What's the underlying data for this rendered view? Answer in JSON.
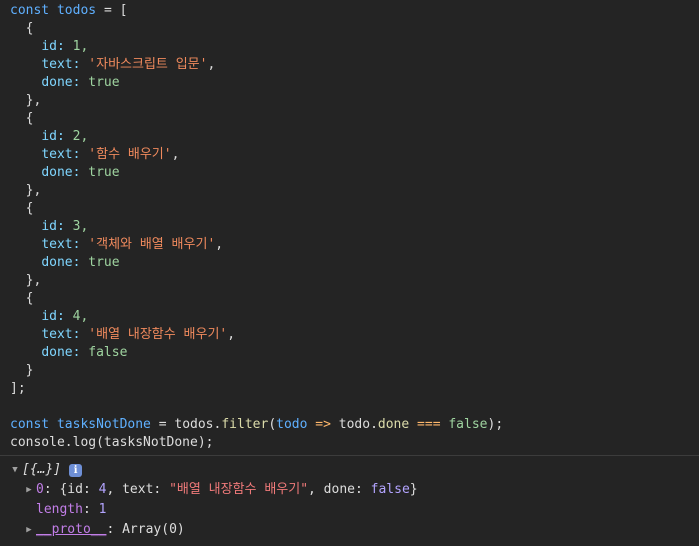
{
  "code": {
    "kw_const": "const",
    "todos_name": "todos",
    "eq": "=",
    "open_bracket": "[",
    "close_bracket": "];",
    "open_brace": "{",
    "close_brace_comma": "},",
    "close_brace": "}",
    "key_id": "id:",
    "key_text": "text:",
    "key_done": "done:",
    "items": [
      {
        "id": "1,",
        "text": "'자바스크립트 입문'",
        "done": "true"
      },
      {
        "id": "2,",
        "text": "'함수 배우기'",
        "done": "true"
      },
      {
        "id": "3,",
        "text": "'객체와 배열 배우기'",
        "done": "true"
      },
      {
        "id": "4,",
        "text": "'배열 내장함수 배우기'",
        "done": "false"
      }
    ],
    "comma": ",",
    "line_filter": {
      "const": "const",
      "var": "tasksNotDone",
      "eq": "=",
      "obj": "todos",
      "dot": ".",
      "method": "filter",
      "open": "(",
      "param": "todo",
      "arrow": "=>",
      "obj2": "todo",
      "dot2": ".",
      "prop": "done",
      "strict_eq": "===",
      "value": "false",
      "close": ");"
    },
    "line_log": "console.log(tasksNotDone);"
  },
  "output": {
    "array_summary": "[{…}]",
    "info_icon": "i",
    "entry_index": "0",
    "entry_colon": ":",
    "entry_open": "{id: ",
    "entry_id": "4",
    "entry_mid1": ", text: ",
    "entry_text": "\"배열 내장함수 배우기\"",
    "entry_mid2": ", done: ",
    "entry_done": "false",
    "entry_close": "}",
    "length_key": "length",
    "length_colon": ":",
    "length_value": "1",
    "proto_key": "__proto__",
    "proto_colon": ":",
    "proto_value": "Array(0)"
  },
  "colors": {
    "background": "#242424",
    "keyword": "#5fb0ff",
    "string": "#f08a5d",
    "number": "#9fd4a0"
  }
}
